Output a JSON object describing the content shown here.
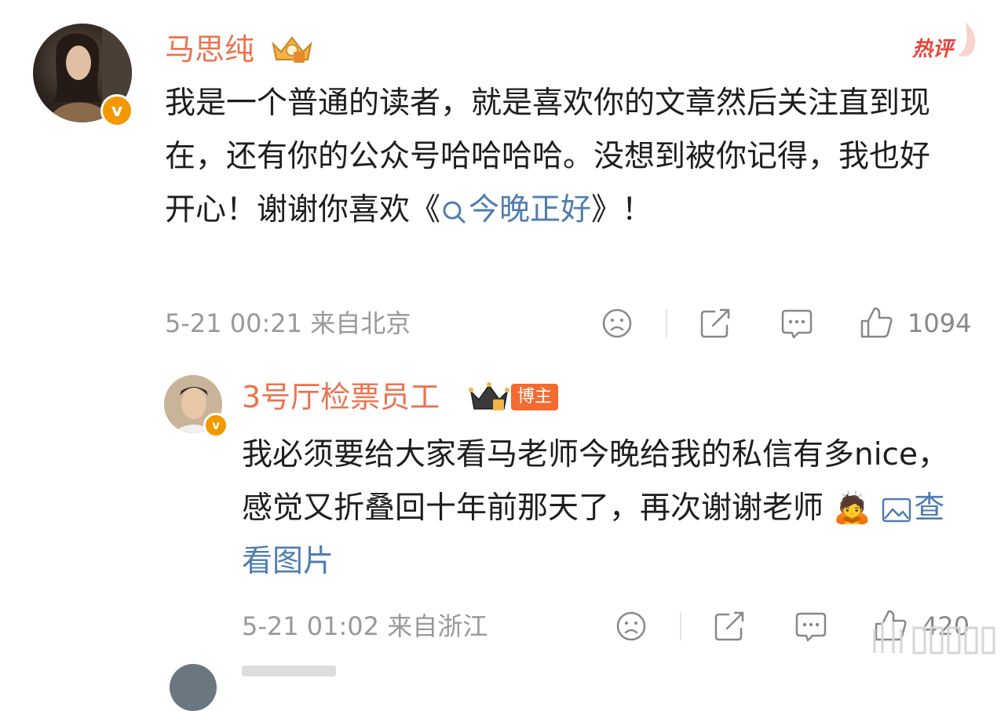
{
  "header": {
    "hot_label": "热评"
  },
  "comments": [
    {
      "author": "马思纯",
      "verified_badge": "v",
      "body_before_link": "我是一个普通的读者，就是喜欢你的文章然后关注直到现在，还有你的公众号哈哈哈哈。没想到被你记得，我也好开心！谢谢你喜欢《",
      "link_text": "今晚正好",
      "body_after_link": "》！",
      "time": "5-21 00:21",
      "location": "来自北京",
      "like_count": "1094"
    },
    {
      "author": "3号厅检票员工",
      "verified_badge": "v",
      "role_badge": "博主",
      "body": "我必须要给大家看马老师今晚给我的私信有多nice，感觉又折叠回十年前那天了，再次谢谢老师",
      "emoji": "🙇",
      "image_link": "查看图片",
      "time": "5-21 01:02",
      "location": "来自浙江",
      "like_count": "420"
    }
  ],
  "colors": {
    "name": "#eb7350",
    "link": "#507daf",
    "meta": "#999999",
    "badge": "#f39800",
    "role_badge": "#f36b30"
  }
}
